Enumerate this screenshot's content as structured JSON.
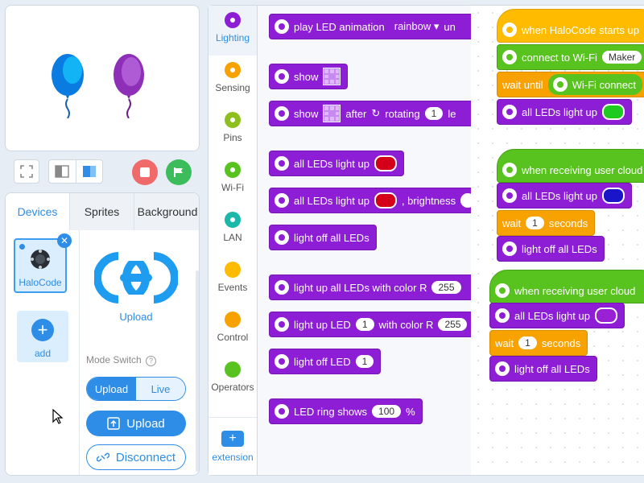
{
  "stage_toolbar": {
    "icons": [
      "fullscreen-icon",
      "small-stage-icon",
      "large-stage-icon",
      "stop-icon",
      "green-flag-icon"
    ]
  },
  "device_panel": {
    "tabs": [
      "Devices",
      "Sprites",
      "Background"
    ],
    "device_name": "HaloCode",
    "add_label": "add",
    "upload_link": "Upload",
    "mode_switch_label": "Mode Switch",
    "mode_options": [
      "Upload",
      "Live"
    ],
    "upload_button": "Upload",
    "disconnect_button": "Disconnect"
  },
  "categories": [
    {
      "name": "Lighting",
      "color": "#8e1ed5"
    },
    {
      "name": "Sensing",
      "color": "#f7a200"
    },
    {
      "name": "Pins",
      "color": "#8fbf1f"
    },
    {
      "name": "Wi-Fi",
      "color": "#58c21f"
    },
    {
      "name": "LAN",
      "color": "#1ab8a8"
    },
    {
      "name": "Events",
      "color": "#ffbb00"
    },
    {
      "name": "Control",
      "color": "#f7a200"
    },
    {
      "name": "Operators",
      "color": "#58c21f"
    }
  ],
  "extension_label": "extension",
  "palette": {
    "b1": {
      "text": "play LED animation",
      "option": "rainbow ▾",
      "tail": "un"
    },
    "b2": {
      "text": "show"
    },
    "b3": {
      "text": "show",
      "after": "after",
      "rot": "rotating",
      "val": "1",
      "tail": "le"
    },
    "b4": {
      "text": "all LEDs light up",
      "color": "#d4001a"
    },
    "b5": {
      "text": "all LEDs light up",
      "color": "#d4001a",
      "tail": ", brightness"
    },
    "b6": {
      "text": "light off all LEDs"
    },
    "b7": {
      "text": "light up all LEDs with color R",
      "val": "255"
    },
    "b8": {
      "text": "light up LED",
      "val": "1",
      "mid": "with color R",
      "val2": "255"
    },
    "b9": {
      "text": "light off LED",
      "val": "1"
    },
    "b10": {
      "text": "LED ring shows",
      "val": "100",
      "tail": "%"
    }
  },
  "workspace": {
    "s1": {
      "hat": "when HaloCode starts up",
      "wifi": "connect to Wi-Fi",
      "wifi_val": "Maker",
      "wait": "wait until",
      "wait_cond": "Wi-Fi connect",
      "led": "all LEDs light up",
      "led_color": "#1ecb1e"
    },
    "s2": {
      "hat": "when receiving user cloud",
      "led": "all LEDs light up",
      "led_color": "#1a15c8",
      "wait": "wait",
      "wait_val": "1",
      "wait_unit": "seconds",
      "off": "light off all LEDs"
    },
    "s3": {
      "hat": "when receiving user cloud",
      "led": "all LEDs light up",
      "led_color": "#9a20d6",
      "wait": "wait",
      "wait_val": "1",
      "wait_unit": "seconds",
      "off": "light off all LEDs"
    }
  }
}
